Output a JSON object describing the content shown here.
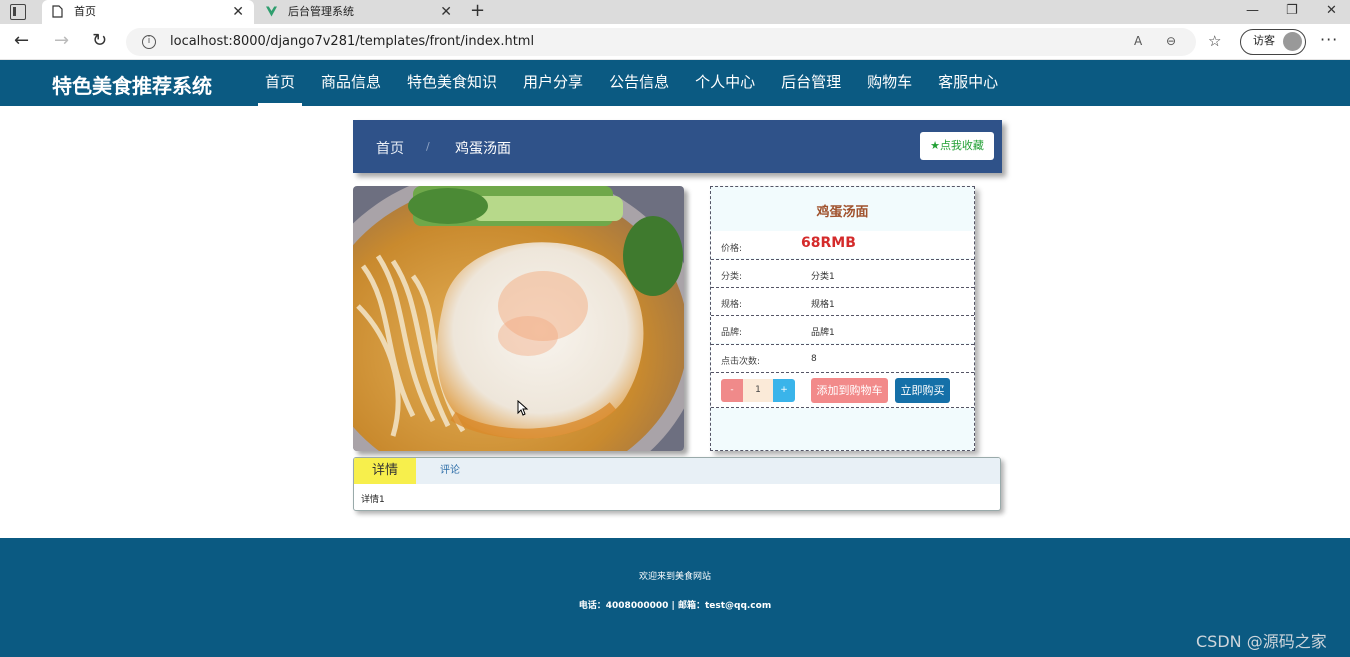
{
  "browser": {
    "tabs": [
      {
        "title": "首页"
      },
      {
        "title": "后台管理系统"
      }
    ],
    "tab_close": "✕",
    "new_tab": "+",
    "window": {
      "minimize": "—",
      "restore": "❐",
      "close": "✕"
    },
    "url": "localhost:8000/django7v281/templates/front/index.html",
    "guest_label": "访客",
    "more": "···"
  },
  "site": {
    "logo": "特色美食推荐系统",
    "nav": [
      "首页",
      "商品信息",
      "特色美食知识",
      "用户分享",
      "公告信息",
      "个人中心",
      "后台管理",
      "购物车",
      "客服中心"
    ],
    "active_nav": "首页"
  },
  "breadcrumb": {
    "home": "首页",
    "separator": "/",
    "current": "鸡蛋汤面",
    "favorite_button": "点我收藏"
  },
  "product": {
    "name": "鸡蛋汤面",
    "price_label": "价格:",
    "price": "68RMB",
    "category_label": "分类:",
    "category": "分类1",
    "spec_label": "规格:",
    "spec": "规格1",
    "brand_label": "品牌:",
    "brand": "品牌1",
    "clicks_label": "点击次数:",
    "clicks": "8",
    "qty_minus": "-",
    "qty": "1",
    "qty_plus": "+",
    "add_to_cart": "添加到购物车",
    "buy_now": "立即购买"
  },
  "tabs": {
    "detail": "详情",
    "review": "评论",
    "content": "详情1"
  },
  "footer": {
    "welcome": "欢迎来到美食网站",
    "contact": "电话：4008000000 | 邮箱：test@qq.com",
    "watermark": "CSDN @源码之家"
  },
  "colors": {
    "nav_bg": "#0b5a82",
    "breadcrumb_bg": "#2f5289",
    "price": "#d42b2b",
    "title": "#a0522d",
    "cart_button": "#f28a8a",
    "buy_button": "#1570a8",
    "detail_tab": "#f7ef4c"
  }
}
